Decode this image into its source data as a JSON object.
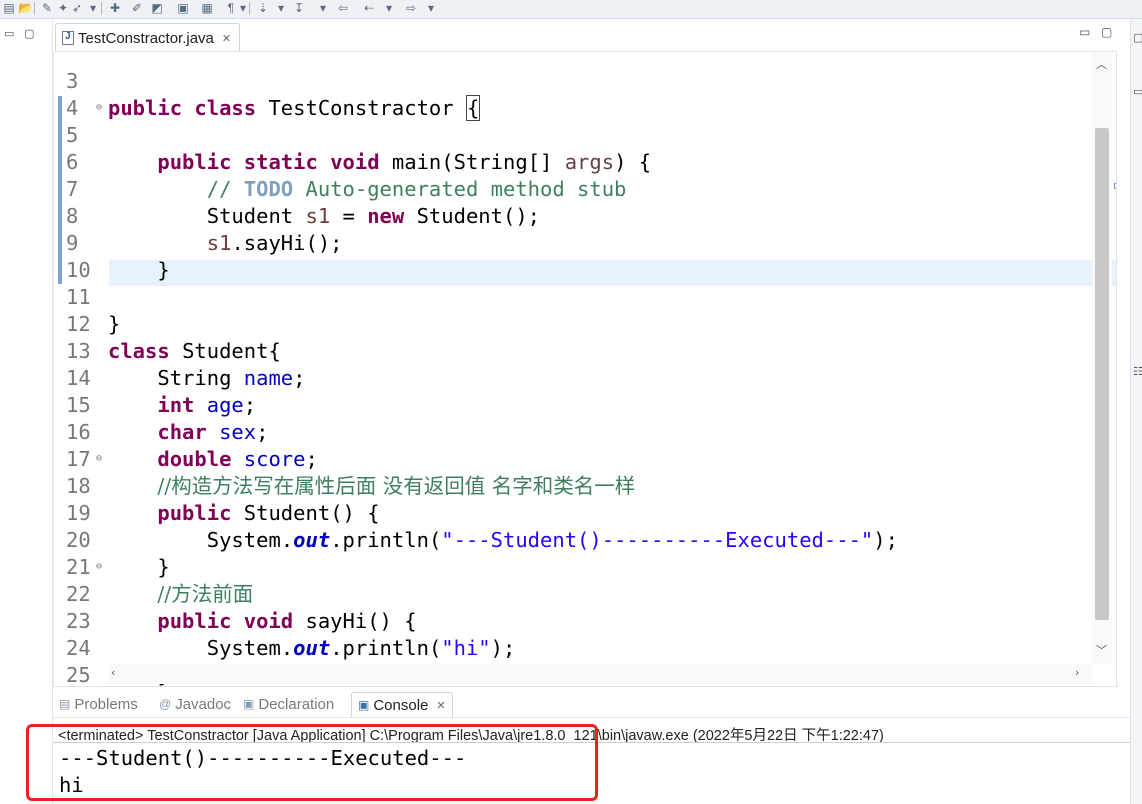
{
  "toolbar": {
    "icons": [
      "open-folder-icon",
      "tools-icon",
      "dropdown-icon",
      "debug-icon",
      "run-icon",
      "edit-icon",
      "new-file-icon",
      "save-icon",
      "pilcrow-icon",
      "annotation-icon",
      "dropdown-icon",
      "next-annotation-icon",
      "prev-annotation-icon",
      "back-icon",
      "dropdown-icon",
      "forward-icon",
      "dropdown-icon"
    ]
  },
  "editor": {
    "tab_label": "TestConstractor.java",
    "tab_close": "✕",
    "lines": [
      {
        "num": "3",
        "text": "public class TestConstractor {"
      },
      {
        "num": "4",
        "text": ""
      },
      {
        "num": "5",
        "text": "    public static void main(String[] args) {"
      },
      {
        "num": "6",
        "text": "        // TODO Auto-generated method stub"
      },
      {
        "num": "7",
        "text": "        Student s1 = new Student();"
      },
      {
        "num": "8",
        "text": "        s1.sayHi();"
      },
      {
        "num": "9",
        "text": "    }"
      },
      {
        "num": "10",
        "text": ""
      },
      {
        "num": "11",
        "text": "}"
      },
      {
        "num": "12",
        "text": "class Student{"
      },
      {
        "num": "13",
        "text": "    String name;"
      },
      {
        "num": "14",
        "text": "    int age;"
      },
      {
        "num": "15",
        "text": "    char sex;"
      },
      {
        "num": "16",
        "text": "    double score;"
      },
      {
        "num": "17",
        "text": "    //构造方法写在属性后面 没有返回值 名字和类名一样"
      },
      {
        "num": "18",
        "text": "    public Student() {"
      },
      {
        "num": "19",
        "text": "        System.out.println(\"---Student()----------Executed---\");"
      },
      {
        "num": "20",
        "text": "    }"
      },
      {
        "num": "21",
        "text": "    //方法前面"
      },
      {
        "num": "22",
        "text": "    public void sayHi() {"
      },
      {
        "num": "23",
        "text": "        System.out.println(\"hi\");"
      },
      {
        "num": "24",
        "text": "    }"
      },
      {
        "num": "25",
        "text": "}"
      }
    ],
    "tokens": {
      "kw_public": "public",
      "kw_class": "class",
      "kw_static": "static",
      "kw_void": "void",
      "kw_new": "new",
      "kw_int": "int",
      "kw_char": "char",
      "kw_double": "double",
      "cls_name": "TestConstractor",
      "student": "Student",
      "string": "String",
      "system": "System",
      "out": "out",
      "println": "println",
      "args": "args",
      "s1": "s1",
      "name": "name",
      "age": "age",
      "sex": "sex",
      "score": "score",
      "todo_slash": "// ",
      "todo": "TODO",
      "todo_rest": " Auto-generated method stub",
      "comment17": "//构造方法写在属性后面 没有返回值 名字和类名一样",
      "comment21": "//方法前面",
      "str19": "\"---Student()----------Executed---\"",
      "str23": "\"hi\"",
      "sayhi": "sayHi"
    }
  },
  "bottom_tabs": [
    {
      "icon": "problems-icon",
      "label": "Problems"
    },
    {
      "icon": "javadoc-icon",
      "label": "Javadoc"
    },
    {
      "icon": "declaration-icon",
      "label": "Declaration"
    },
    {
      "icon": "console-icon",
      "label": "Console"
    }
  ],
  "console": {
    "status": "<terminated> TestConstractor [Java Application] C:\\Program Files\\Java\\jre1.8.0_121\\bin\\javaw.exe (2022年5月22日 下午1:22:47)",
    "output": [
      "---Student()----------Executed---",
      "hi"
    ]
  },
  "colors": {
    "keyword": "#7f0055",
    "comment": "#3f7f5f",
    "string": "#2a00ff",
    "field": "#0000c0",
    "highlight_box": "#e8231f",
    "current_line": "#e8f2fe"
  }
}
